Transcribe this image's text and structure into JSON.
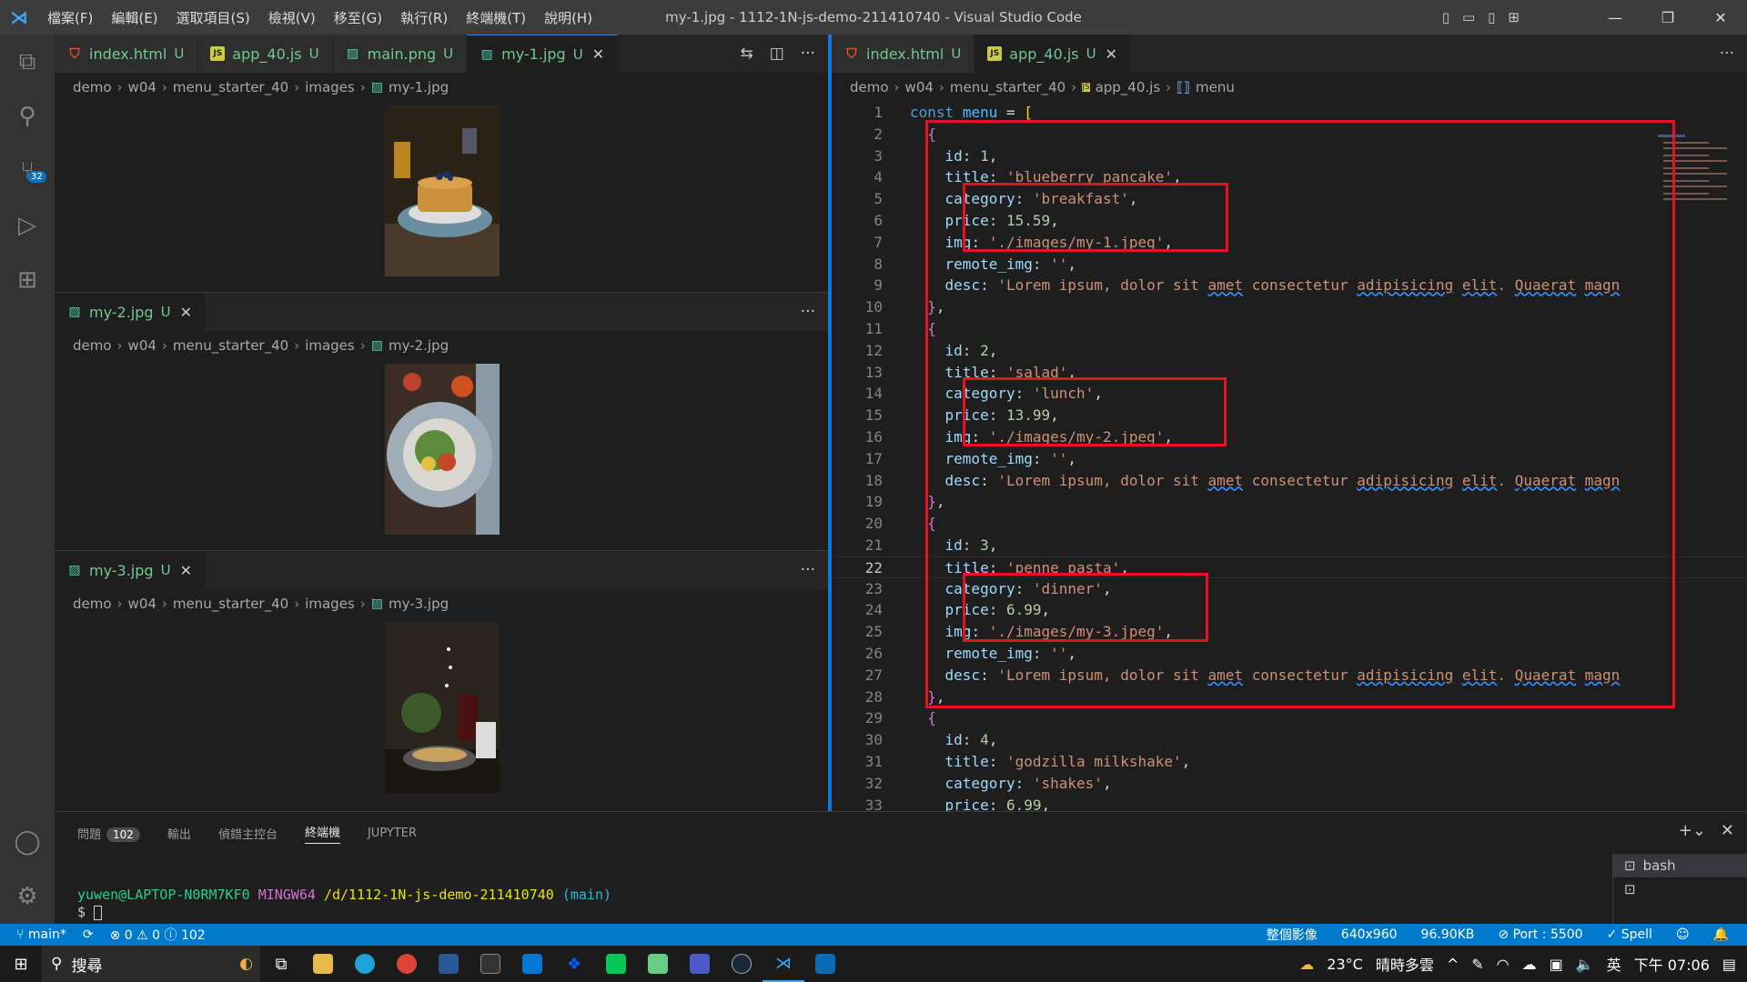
{
  "titlebar": {
    "menu": [
      "檔案(F)",
      "編輯(E)",
      "選取項目(S)",
      "檢視(V)",
      "移至(G)",
      "執行(R)",
      "終端機(T)",
      "說明(H)"
    ],
    "window_title": "my-1.jpg - 1112-1N-js-demo-211410740 - Visual Studio Code"
  },
  "activity": {
    "scm_badge": "32"
  },
  "left_tabs": [
    {
      "label": "index.html",
      "status": "U",
      "type": "html"
    },
    {
      "label": "app_40.js",
      "status": "U",
      "type": "js"
    },
    {
      "label": "main.png",
      "status": "U",
      "type": "img"
    },
    {
      "label": "my-1.jpg",
      "status": "U",
      "type": "img"
    }
  ],
  "image_panes": [
    {
      "tab": "my-2.jpg",
      "status": "U",
      "crumbs": [
        "demo",
        "w04",
        "menu_starter_40",
        "images",
        "my-2.jpg"
      ]
    },
    {
      "tab": "my-3.jpg",
      "status": "U",
      "crumbs": [
        "demo",
        "w04",
        "menu_starter_40",
        "images",
        "my-3.jpg"
      ]
    }
  ],
  "pane1_crumbs": [
    "demo",
    "w04",
    "menu_starter_40",
    "images",
    "my-1.jpg"
  ],
  "right_tabs": [
    {
      "label": "index.html",
      "status": "U",
      "type": "html"
    },
    {
      "label": "app_40.js",
      "status": "U",
      "type": "js"
    }
  ],
  "right_crumbs": [
    "demo",
    "w04",
    "menu_starter_40",
    "app_40.js",
    "menu"
  ],
  "code": {
    "current_line": 22,
    "desc_text": "'Lorem ipsum, dolor sit amet consectetur adipisicing elit. Quaerat magn",
    "items": [
      {
        "id": "1",
        "title": "'blueberry pancake'",
        "category": "'breakfast'",
        "price": "15.59",
        "img": "'./images/my-1.jpeg'"
      },
      {
        "id": "2",
        "title": "'salad'",
        "category": "'lunch'",
        "price": "13.99",
        "img": "'./images/my-2.jpeg'"
      },
      {
        "id": "3",
        "title": "'penne pasta'",
        "category": "'dinner'",
        "price": "6.99",
        "img": "'./images/my-3.jpeg'"
      },
      {
        "id": "4",
        "title": "'godzilla milkshake'",
        "category": "'shakes'",
        "price": "6.99"
      }
    ]
  },
  "panel": {
    "tabs": [
      "問題",
      "輸出",
      "偵錯主控台",
      "終端機",
      "JUPYTER"
    ],
    "problems_count": "102",
    "active_tab": "終端機",
    "prompt_user": "yuwen@LAPTOP-N0RM7KF0",
    "prompt_env": "MINGW64",
    "prompt_path": "/d/1112-1N-js-demo-211410740",
    "prompt_branch": "(main)",
    "prompt_symbol": "$",
    "terminals": [
      "bash"
    ]
  },
  "statusbar": {
    "branch": "main*",
    "errors": "0",
    "warnings": "0",
    "infos": "102",
    "image_preview": "整個影像",
    "dimensions": "640x960",
    "file_size": "96.90KB",
    "port": "Port : 5500",
    "spell": "Spell"
  },
  "taskbar": {
    "search": "搜尋",
    "temperature": "23°C",
    "weather": "晴時多雲",
    "ime": "英",
    "time": "下午 07:06"
  },
  "colors": {
    "accent": "#007acc",
    "highlight": "#e81123",
    "untracked": "#73c991"
  }
}
